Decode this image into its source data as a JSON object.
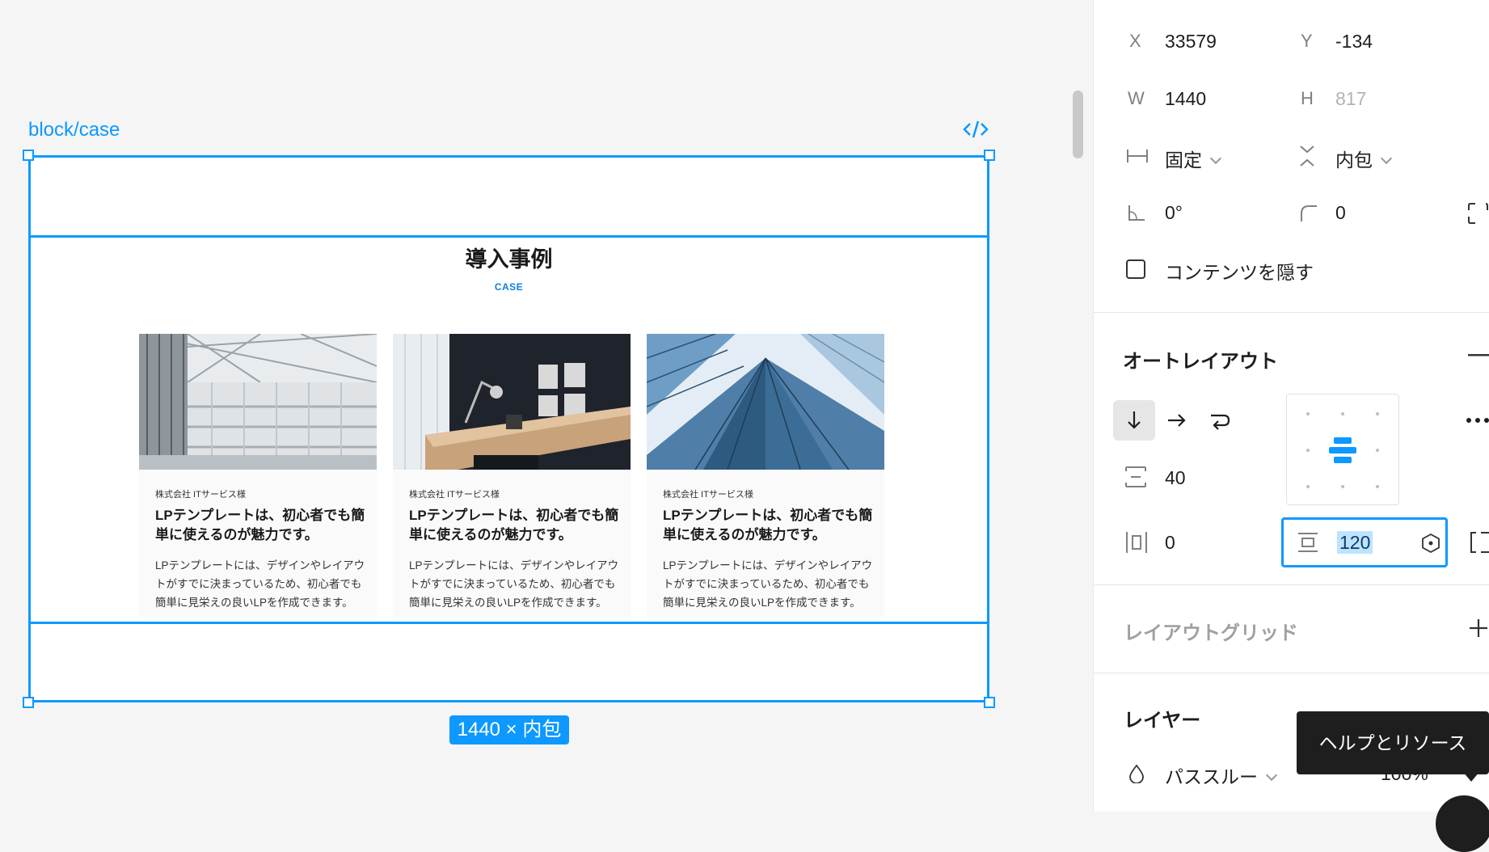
{
  "canvas": {
    "frame_name": "block/case",
    "size_badge": "1440 × 内包",
    "section": {
      "title": "導入事例",
      "subtitle": "CASE"
    },
    "cards": [
      {
        "company": "株式会社 ITサービス様",
        "title": "LPテンプレートは、初心者でも簡単に使えるのが魅力です。",
        "body": "LPテンプレートには、デザインやレイアウトがすでに決まっているため、初心者でも簡単に見栄えの良いLPを作成できます。"
      },
      {
        "company": "株式会社 ITサービス様",
        "title": "LPテンプレートは、初心者でも簡単に使えるのが魅力です。",
        "body": "LPテンプレートには、デザインやレイアウトがすでに決まっているため、初心者でも簡単に見栄えの良いLPを作成できます。"
      },
      {
        "company": "株式会社 ITサービス様",
        "title": "LPテンプレートは、初心者でも簡単に使えるのが魅力です。",
        "body": "LPテンプレートには、デザインやレイアウトがすでに決まっているため、初心者でも簡単に見栄えの良いLPを作成できます。"
      }
    ]
  },
  "panel": {
    "x_label": "X",
    "x_value": "33579",
    "y_label": "Y",
    "y_value": "-134",
    "w_label": "W",
    "w_value": "1440",
    "h_label": "H",
    "h_value": "817",
    "width_mode": "固定",
    "height_mode": "内包",
    "rotation": "0°",
    "corner_radius": "0",
    "clip_content_label": "コンテンツを隠す",
    "autolayout_heading": "オートレイアウト",
    "gap_value": "40",
    "horizontal_padding": "0",
    "vertical_padding": "120",
    "layout_grid_heading": "レイアウトグリッド",
    "layers_heading": "レイヤー",
    "blend_mode": "パススルー",
    "opacity": "100%",
    "tooltip": "ヘルプとリソース"
  },
  "colors": {
    "accent": "#0d99ff",
    "panel_bg": "#ffffff",
    "canvas_bg": "#f5f5f5"
  }
}
